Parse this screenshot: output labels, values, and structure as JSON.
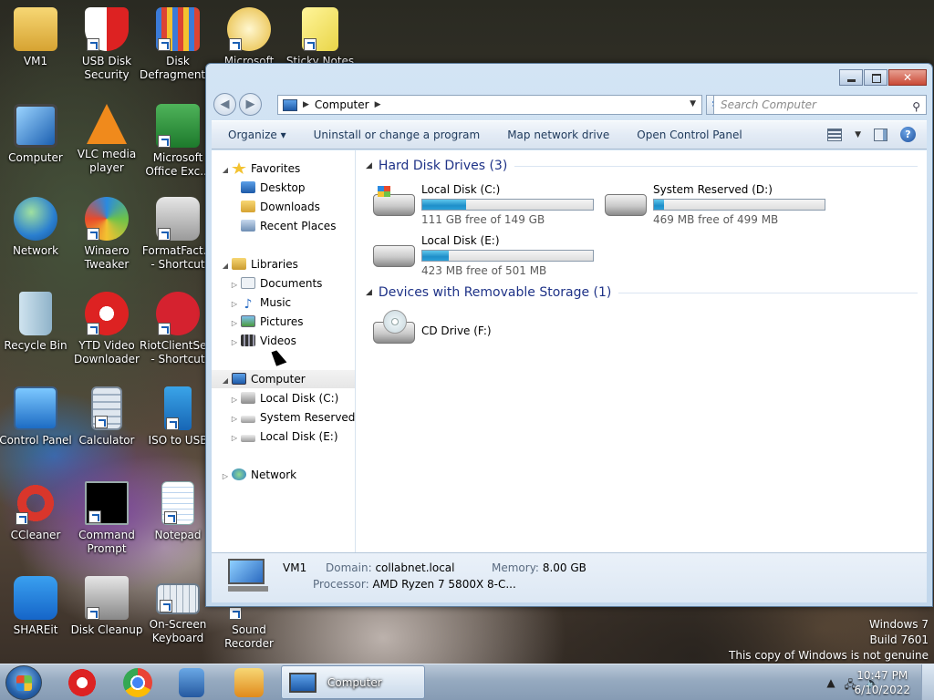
{
  "desktop": {
    "icons": [
      {
        "label": "VM1"
      },
      {
        "label": "USB Disk Security"
      },
      {
        "label": "Disk Defragmenter"
      },
      {
        "label": "Microsoft"
      },
      {
        "label": "Sticky Notes"
      },
      {
        "label": "Computer"
      },
      {
        "label": "VLC media player"
      },
      {
        "label": "Microsoft Office Exc..."
      },
      {
        "label": "Network"
      },
      {
        "label": "Winaero Tweaker"
      },
      {
        "label": "FormatFact... - Shortcut"
      },
      {
        "label": "Recycle Bin"
      },
      {
        "label": "YTD Video Downloader"
      },
      {
        "label": "RiotClientSe... - Shortcut"
      },
      {
        "label": "Control Panel"
      },
      {
        "label": "Calculator"
      },
      {
        "label": "ISO to USB"
      },
      {
        "label": "CCleaner"
      },
      {
        "label": "Command Prompt"
      },
      {
        "label": "Notepad"
      },
      {
        "label": "SHAREit"
      },
      {
        "label": "Disk Cleanup"
      },
      {
        "label": "On-Screen Keyboard"
      },
      {
        "label": "Sound Recorder"
      }
    ],
    "watermark": {
      "line1": "Windows 7",
      "line2": "Build 7601",
      "line3": "This copy of Windows is not genuine"
    }
  },
  "explorer": {
    "address": {
      "crumb": "Computer"
    },
    "search": {
      "placeholder": "Search Computer"
    },
    "toolbar": {
      "organize": "Organize",
      "uninstall": "Uninstall or change a program",
      "map_drive": "Map network drive",
      "control_panel": "Open Control Panel"
    },
    "nav": {
      "favorites": "Favorites",
      "desktop": "Desktop",
      "downloads": "Downloads",
      "recent": "Recent Places",
      "libraries": "Libraries",
      "documents": "Documents",
      "music": "Music",
      "pictures": "Pictures",
      "videos": "Videos",
      "computer": "Computer",
      "local_c": "Local Disk (C:)",
      "system_d": "System Reserved (D:",
      "local_e": "Local Disk (E:)",
      "network": "Network"
    },
    "groups": {
      "hdd": "Hard Disk Drives (3)",
      "removable": "Devices with Removable Storage (1)"
    },
    "drives": {
      "c": {
        "name": "Local Disk (C:)",
        "free": "111 GB free of 149 GB",
        "used_fraction": 0.255
      },
      "d": {
        "name": "System Reserved (D:)",
        "free": "469 MB free of 499 MB",
        "used_fraction": 0.06
      },
      "e": {
        "name": "Local Disk (E:)",
        "free": "423 MB free of 501 MB",
        "used_fraction": 0.156
      },
      "f": {
        "name": "CD Drive (F:)"
      }
    },
    "details": {
      "name": "VM1",
      "domain_label": "Domain:",
      "domain_value": "collabnet.local",
      "memory_label": "Memory:",
      "memory_value": "8.00 GB",
      "processor_label": "Processor:",
      "processor_value": "AMD Ryzen 7 5800X 8-C..."
    }
  },
  "taskbar": {
    "active_window": "Computer",
    "time": "10:47 PM",
    "date": "6/10/2022"
  }
}
